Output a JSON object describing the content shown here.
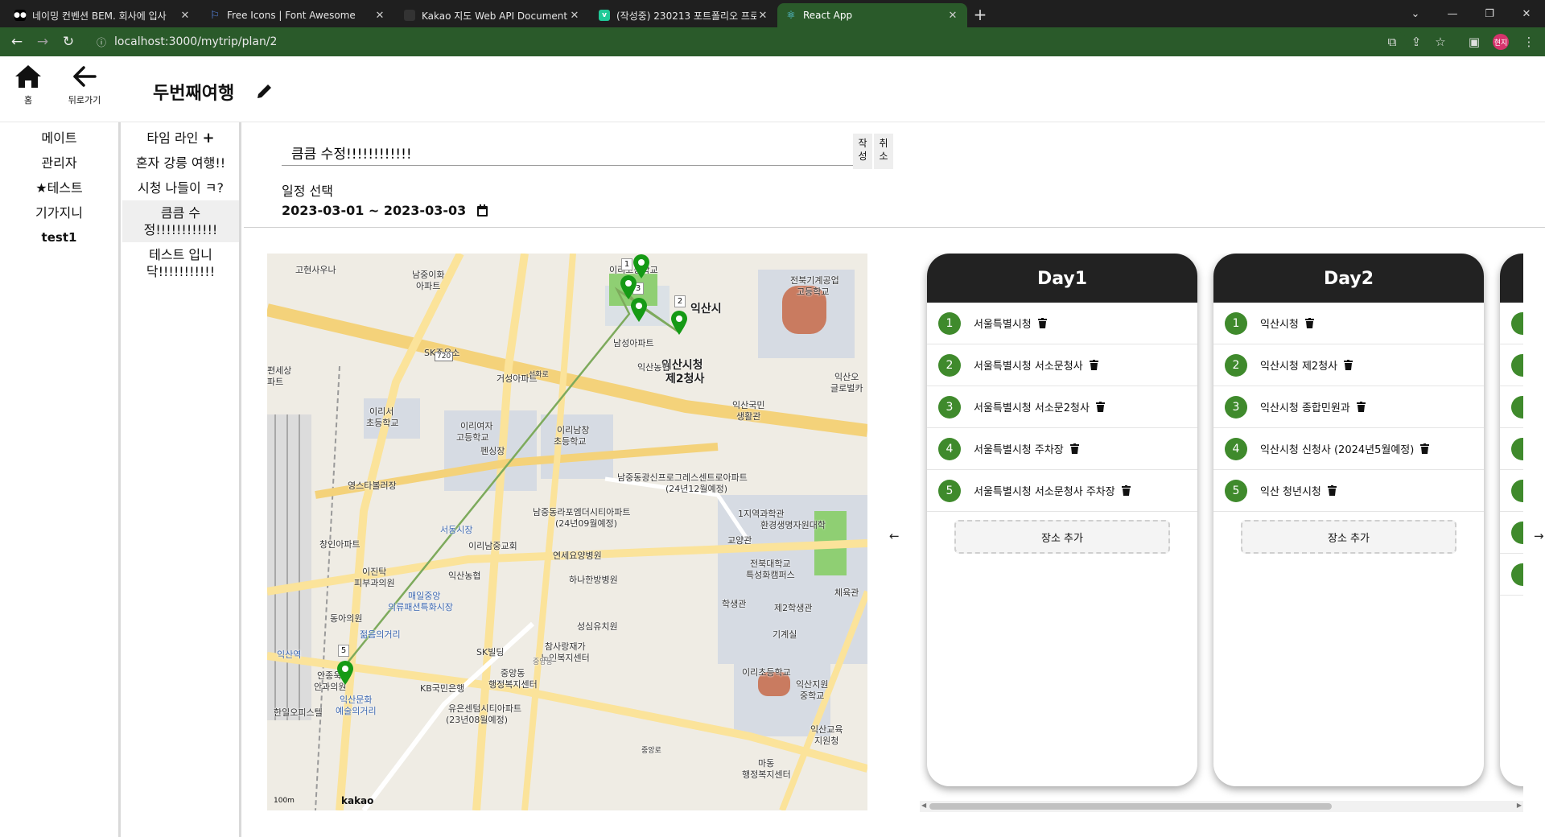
{
  "browser": {
    "tabs": [
      {
        "title": "네이밍 컨벤션 BEM. 회사에 입사",
        "favicon": "medium-icon"
      },
      {
        "title": "Free Icons | Font Awesome",
        "favicon": "flag-icon"
      },
      {
        "title": "Kakao 지도 Web API Document",
        "favicon": "kakao-icon"
      },
      {
        "title": "(작성중) 230213 포트폴리오 프로",
        "favicon": "velog-icon"
      },
      {
        "title": "React App",
        "favicon": "react-icon"
      }
    ],
    "url": "localhost:3000/mytrip/plan/2",
    "profile_initials": "현지",
    "tab_close": "✕",
    "new_tab": "+"
  },
  "header": {
    "home_label": "홈",
    "back_label": "뒤로가기",
    "trip_title": "두번째여행"
  },
  "mates": [
    "메이트",
    "관리자",
    "테스트",
    "기가지니",
    "test1"
  ],
  "plans": {
    "timeline_label": "타임 라인",
    "items": [
      "혼자 강릉 여행!!",
      "시청 나들이 ㅋ?",
      "큼큼 수정!!!!!!!!!!!!",
      "테스트 입니닥!!!!!!!!!!!"
    ]
  },
  "editor": {
    "title_value": "큼큼 수정!!!!!!!!!!!!",
    "write_label_1": "작",
    "write_label_2": "성",
    "cancel_label_1": "취",
    "cancel_label_2": "소",
    "schedule_label": "일정 선택",
    "date_range": "2023-03-01 ~ 2023-03-03"
  },
  "map": {
    "logo": "kakao",
    "scale_label": "100m",
    "labels": [
      {
        "text": "고현사우나"
      },
      {
        "text": "남중이화"
      },
      {
        "text": "아파트"
      },
      {
        "text": "이리고등학교"
      },
      {
        "text": "익산시청"
      },
      {
        "text": "제2청사"
      },
      {
        "text": "전북기계공업"
      },
      {
        "text": "고등학교"
      },
      {
        "text": "SK주유소"
      },
      {
        "text": "남성아파트"
      },
      {
        "text": "익산농협"
      },
      {
        "text": "거성아파트"
      },
      {
        "text": "이리서"
      },
      {
        "text": "초등학교"
      },
      {
        "text": "이리여자"
      },
      {
        "text": "고등학교"
      },
      {
        "text": "이리남창"
      },
      {
        "text": "초등학교"
      },
      {
        "text": "익산국민"
      },
      {
        "text": "생활관"
      },
      {
        "text": "영스타볼러장"
      },
      {
        "text": "남중동광신프로그레스센트로아파트"
      },
      {
        "text": "(24년12월예정)"
      },
      {
        "text": "남중동라포엠더시티아파트"
      },
      {
        "text": "(24년09월예정)"
      },
      {
        "text": "서동시장"
      },
      {
        "text": "이리남중교회"
      },
      {
        "text": "연세요양병원"
      },
      {
        "text": "창인아파트"
      },
      {
        "text": "이진탁"
      },
      {
        "text": "피부과의원"
      },
      {
        "text": "익산농협"
      },
      {
        "text": "하나한방병원"
      },
      {
        "text": "매일중앙"
      },
      {
        "text": "의류패션특화시장"
      },
      {
        "text": "성심유치원"
      },
      {
        "text": "동아의원"
      },
      {
        "text": "젊음의거리"
      },
      {
        "text": "SK빌딩"
      },
      {
        "text": "참사랑재가"
      },
      {
        "text": "노인복지센터"
      },
      {
        "text": "익산역"
      },
      {
        "text": "안종욱"
      },
      {
        "text": "안과의원"
      },
      {
        "text": "중앙동"
      },
      {
        "text": "행정복지센터"
      },
      {
        "text": "KB국민은행"
      },
      {
        "text": "익산문화"
      },
      {
        "text": "예술의거리"
      },
      {
        "text": "한일오피스텔"
      },
      {
        "text": "유은센텀시티아파트"
      },
      {
        "text": "(23년08월예정)"
      },
      {
        "text": "1지역과학관"
      },
      {
        "text": "환경생명자원대학"
      },
      {
        "text": "교양관"
      },
      {
        "text": "전북대학교"
      },
      {
        "text": "특성화캠퍼스"
      },
      {
        "text": "학생관"
      },
      {
        "text": "제2학생관"
      },
      {
        "text": "체육관"
      },
      {
        "text": "기계실"
      },
      {
        "text": "이리초등학교"
      },
      {
        "text": "익산지원"
      },
      {
        "text": "중학교"
      },
      {
        "text": "익산교육"
      },
      {
        "text": "지원청"
      },
      {
        "text": "마동"
      },
      {
        "text": "행정복지센터"
      },
      {
        "text": "익산오"
      },
      {
        "text": "글로벌카"
      },
      {
        "text": "펜싱장"
      },
      {
        "text": "익산시"
      },
      {
        "text": "편세상"
      },
      {
        "text": "파트"
      },
      {
        "text": "720"
      },
      {
        "text": "선화로"
      },
      {
        "text": "중앙로"
      },
      {
        "text": "중앙동"
      }
    ],
    "pins": [
      {
        "number": "1"
      },
      {
        "number": "3"
      },
      {
        "number": "2"
      },
      {
        "number": "5"
      }
    ]
  },
  "days": [
    {
      "title": "Day1",
      "places": [
        "서울특별시청",
        "서울특별시청 서소문청사",
        "서울특별시청 서소문2청사",
        "서울특별시청 주차장",
        "서울특별시청 서소문청사 주차장"
      ]
    },
    {
      "title": "Day2",
      "places": [
        "익산시청",
        "익산시청 제2청사",
        "익산시청 종합민원과",
        "익산시청 신청사 (2024년5월예정)",
        "익산 청년시청"
      ]
    }
  ],
  "add_place_label": "장소 추가",
  "numbers": [
    "1",
    "2",
    "3",
    "4",
    "5"
  ],
  "colors": {
    "accent_green": "#3f8a2c",
    "browser_green": "#2a5a2a",
    "day_header": "#222222"
  }
}
